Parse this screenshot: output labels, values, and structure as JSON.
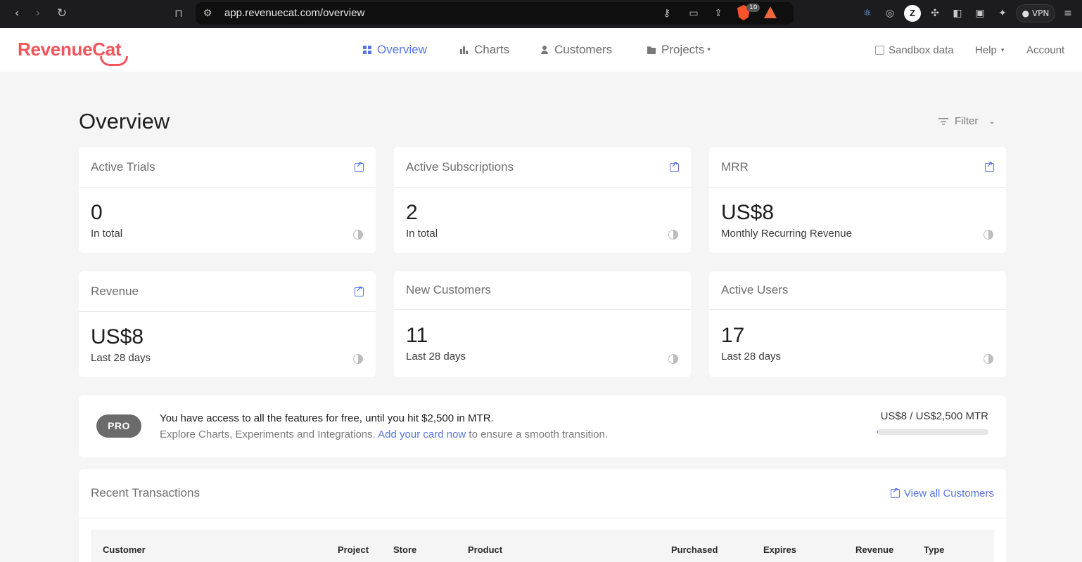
{
  "browser": {
    "url": "app.revenuecat.com/overview",
    "brave_badge_count": "10",
    "profile_initial": "Z",
    "vpn_label": "VPN"
  },
  "brand": {
    "logo_text": "RevenueCat",
    "accent_color": "#f2545b",
    "link_color": "#5873e6"
  },
  "nav": {
    "overview": "Overview",
    "charts": "Charts",
    "customers": "Customers",
    "projects": "Projects"
  },
  "header_right": {
    "sandbox": "Sandbox data",
    "help": "Help",
    "account": "Account"
  },
  "page": {
    "title": "Overview",
    "filter": "Filter"
  },
  "cards": [
    {
      "title": "Active Trials",
      "value": "0",
      "sub": "In total"
    },
    {
      "title": "Active Subscriptions",
      "value": "2",
      "sub": "In total"
    },
    {
      "title": "MRR",
      "value": "US$8",
      "sub": "Monthly Recurring Revenue"
    },
    {
      "title": "Revenue",
      "value": "US$8",
      "sub": "Last 28 days"
    },
    {
      "title": "New Customers",
      "value": "11",
      "sub": "Last 28 days"
    },
    {
      "title": "Active Users",
      "value": "17",
      "sub": "Last 28 days"
    }
  ],
  "pro_banner": {
    "badge": "PRO",
    "line1": "You have access to all the features for free, until you hit $2,500 in MTR.",
    "line2_before": "Explore Charts, Experiments and Integrations.",
    "line2_link": "Add your card now",
    "line2_after": "to ensure a smooth transition.",
    "mtr_text": "US$8 / US$2,500 MTR",
    "mtr_fraction": 0.0032
  },
  "transactions": {
    "title": "Recent Transactions",
    "view_all": "View all Customers",
    "columns": [
      "Customer",
      "Project",
      "Store",
      "Product",
      "Purchased",
      "Expires",
      "Revenue",
      "Type"
    ]
  }
}
